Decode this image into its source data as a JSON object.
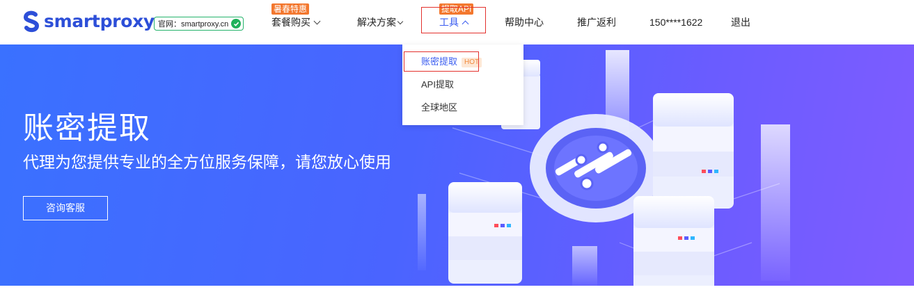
{
  "brand": {
    "name": "smartproxy",
    "site_badge": "官网：smartproxy.cn",
    "colors": {
      "brand_blue": "#2d4fd8",
      "accent": "#3a5cf0",
      "ribbon": "#f3772e",
      "highlight_box": "#e3312d"
    }
  },
  "nav": {
    "plans": {
      "label": "套餐购买",
      "ribbon": "暑春特惠"
    },
    "solutions": {
      "label": "解决方案"
    },
    "tools": {
      "label": "工具",
      "ribbon": "提取API"
    },
    "help": {
      "label": "帮助中心"
    },
    "referral": {
      "label": "推广返利"
    },
    "account": {
      "label": "150****1622"
    },
    "logout": {
      "label": "退出"
    }
  },
  "tools_menu": {
    "items": [
      {
        "label": "账密提取",
        "badge": "HOT"
      },
      {
        "label": "API提取"
      },
      {
        "label": "全球地区"
      }
    ]
  },
  "hero": {
    "title": "账密提取",
    "subtitle": "代理为您提供专业的全方位服务保障，请您放心使用",
    "cta": "咨询客服"
  },
  "icons": [
    "smartproxy-logo-icon",
    "check-icon",
    "chevron-down-icon",
    "chevron-up-icon",
    "server-illustration"
  ]
}
